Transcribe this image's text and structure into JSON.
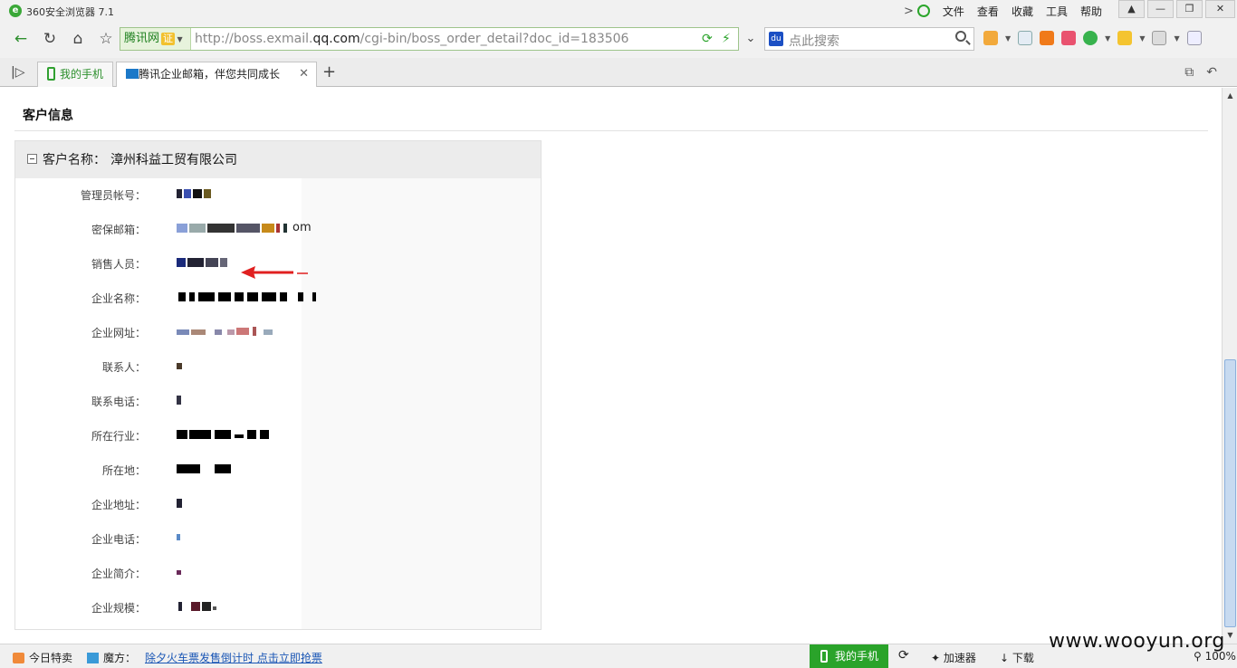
{
  "titlebar": {
    "title": "360安全浏览器 7.1",
    "menu": [
      "文件",
      "查看",
      "收藏",
      "工具",
      "帮助"
    ]
  },
  "navbar": {
    "cert_label": "腾讯网",
    "cert_badge": "证",
    "url_prefix": "http://boss.exmail.",
    "url_domain": "qq.com",
    "url_path": "/cgi-bin/boss_order_detail?doc_id=183506",
    "search_placeholder": "点此搜索"
  },
  "tabs": [
    {
      "label": "我的手机"
    },
    {
      "label": "腾讯企业邮箱，伴您共同成长"
    }
  ],
  "content": {
    "section_title": "客户信息",
    "customer_name_label": "客户名称：",
    "customer_name_value": "漳州科益工贸有限公司",
    "fields": [
      {
        "label": "管理员帐号："
      },
      {
        "label": "密保邮箱：",
        "visible_suffix": "om"
      },
      {
        "label": "销售人员："
      },
      {
        "label": "企业名称："
      },
      {
        "label": "企业网址："
      },
      {
        "label": "联系人："
      },
      {
        "label": "联系电话："
      },
      {
        "label": "所在行业："
      },
      {
        "label": "所在地："
      },
      {
        "label": "企业地址："
      },
      {
        "label": "企业电话："
      },
      {
        "label": "企业简介："
      },
      {
        "label": "企业规模："
      }
    ]
  },
  "statusbar": {
    "today_sale": "今日特卖",
    "magic": "魔方：",
    "promo_link": "除夕火车票发售倒计时   点击立即抢票",
    "phone": "我的手机",
    "accelerator": "加速器",
    "download": "下载",
    "zoom": "100%"
  },
  "watermark": "www.wooyun.org",
  "colors": {
    "accent_green": "#2aa32a",
    "link_blue": "#1a56b5",
    "annotation_red": "#e02020"
  }
}
